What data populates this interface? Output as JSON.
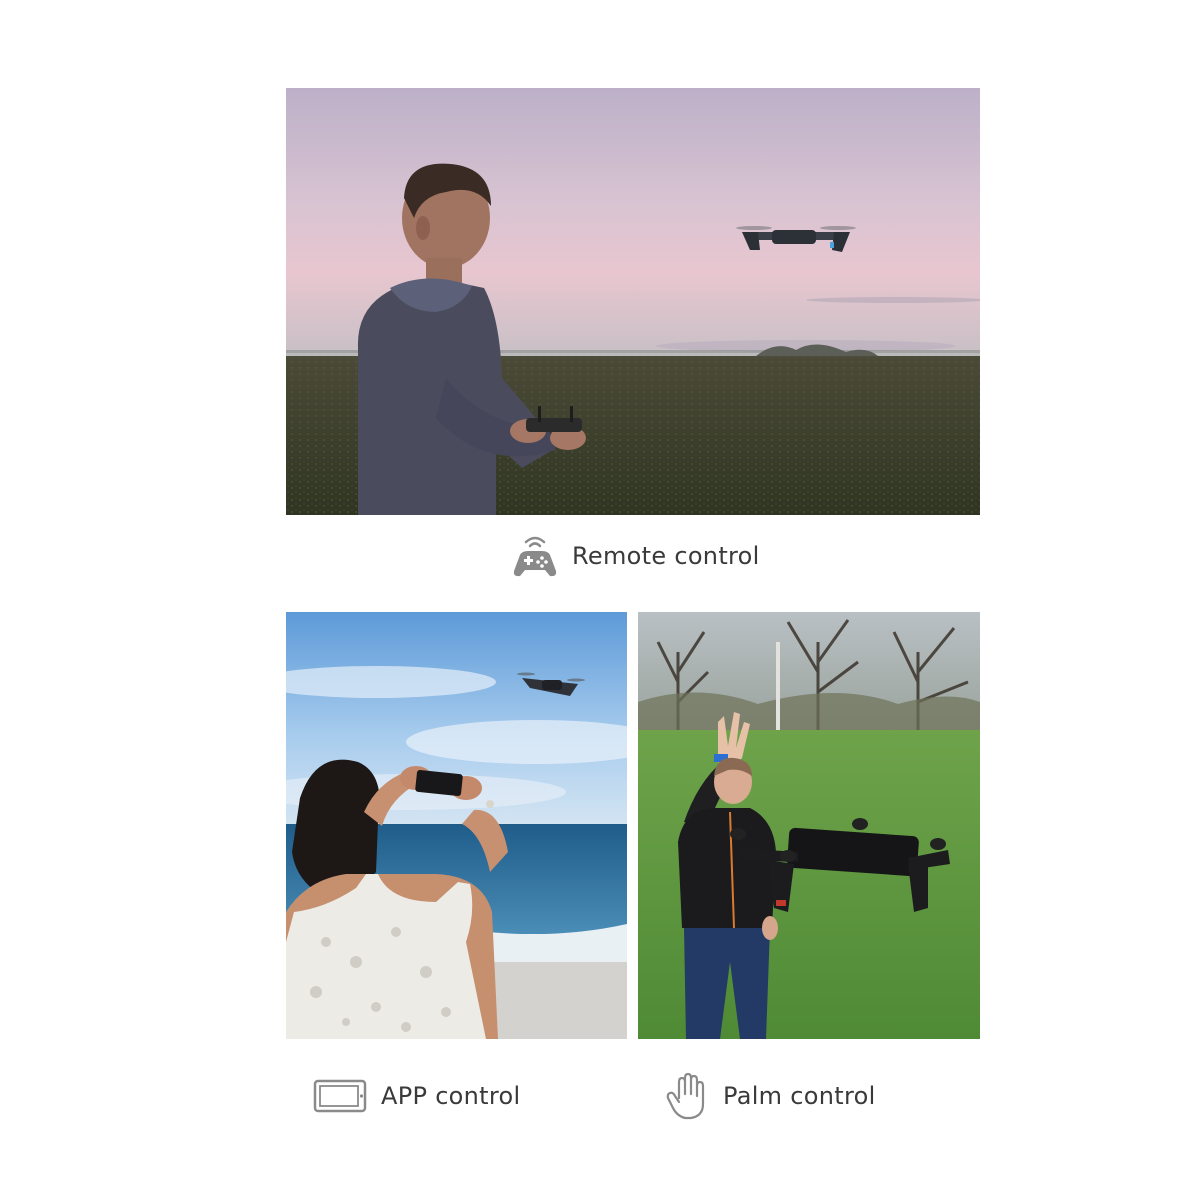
{
  "captions": {
    "remote": {
      "label": "Remote control",
      "icon": "gamepad-icon"
    },
    "app": {
      "label": "APP control",
      "icon": "tablet-icon"
    },
    "palm": {
      "label": "Palm control",
      "icon": "hand-icon"
    }
  },
  "colors": {
    "caption_text": "#3a3a3a",
    "icon_gray": "#8a8a8a",
    "background": "#ffffff"
  }
}
